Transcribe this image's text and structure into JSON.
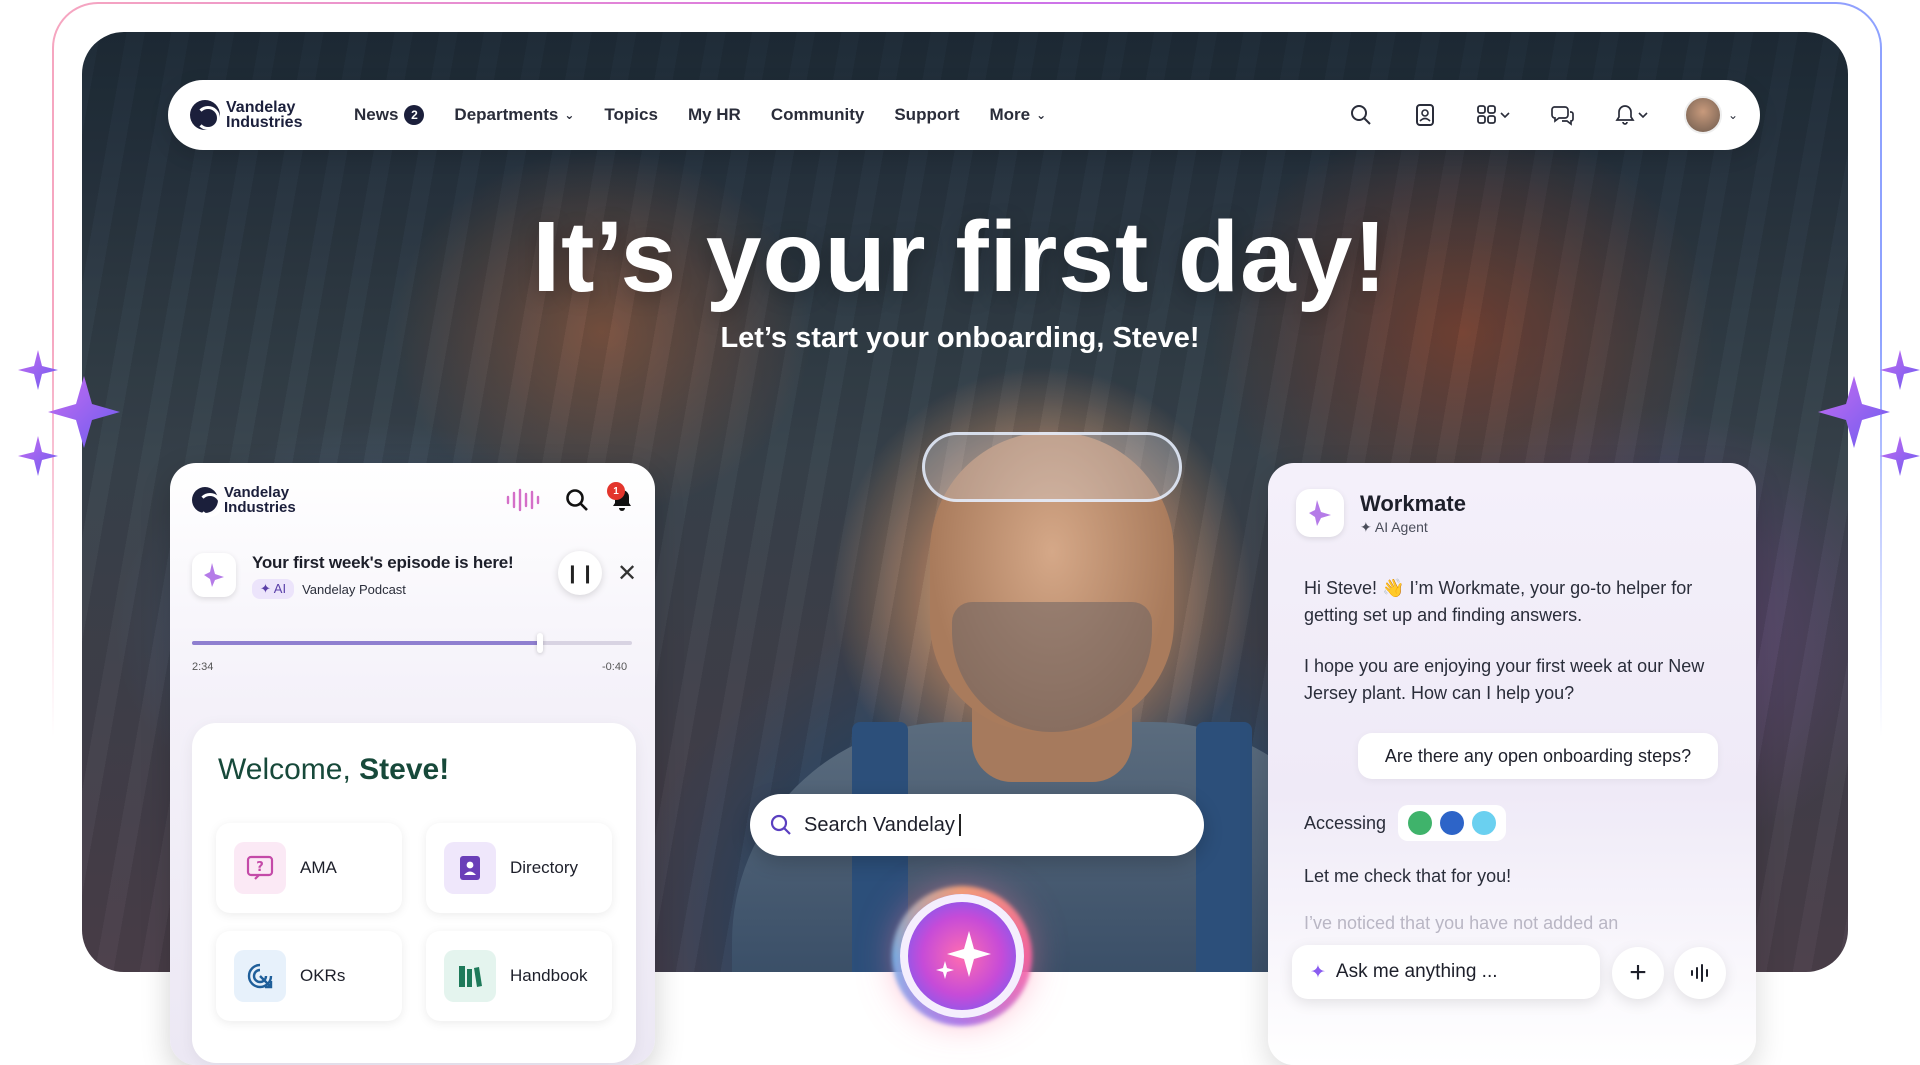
{
  "brand": {
    "name_line1": "Vandelay",
    "name_line2": "Industries"
  },
  "nav": {
    "items": [
      {
        "label": "News",
        "badge": "2"
      },
      {
        "label": "Departments",
        "dropdown": true
      },
      {
        "label": "Topics"
      },
      {
        "label": "My HR"
      },
      {
        "label": "Community"
      },
      {
        "label": "Support"
      },
      {
        "label": "More",
        "dropdown": true
      }
    ],
    "icons": [
      "search-icon",
      "contact-card-icon",
      "apps-grid-icon",
      "chat-icon",
      "bell-icon",
      "avatar"
    ]
  },
  "hero": {
    "title": "It’s your first day!",
    "subtitle": "Let’s start your onboarding, Steve!"
  },
  "search": {
    "value": "Search Vandelay"
  },
  "mobile": {
    "notification_count": "1",
    "episode": {
      "title": "Your first week's episode is here!",
      "ai_label": "AI",
      "source": "Vandelay Podcast",
      "elapsed": "2:34",
      "remaining": "-0:40",
      "progress": 0.79
    },
    "welcome": {
      "greeting": "Welcome,",
      "name": "Steve!"
    },
    "tiles": [
      {
        "label": "AMA",
        "icon": "question-board-icon"
      },
      {
        "label": "Directory",
        "icon": "address-book-icon"
      },
      {
        "label": "OKRs",
        "icon": "target-click-icon"
      },
      {
        "label": "Handbook",
        "icon": "books-icon"
      }
    ]
  },
  "workmate": {
    "title": "Workmate",
    "subtitle": "AI Agent",
    "msg1": "Hi Steve! 👋 I’m Workmate, your go-to helper for getting set up and finding answers.",
    "msg2": "I hope you are enjoying your first week at our New Jersey plant. How can I help you?",
    "user_msg": "Are there any open onboarding steps?",
    "accessing": "Accessing",
    "msg3": "Let me check that for you!",
    "msg4_faded": "I’ve noticed that you have not added an",
    "ask_placeholder": "Ask me anything ..."
  },
  "colors": {
    "accent": "#8a5cf0",
    "brand_dark": "#1b1f3b",
    "welcome_green": "#17493a"
  }
}
